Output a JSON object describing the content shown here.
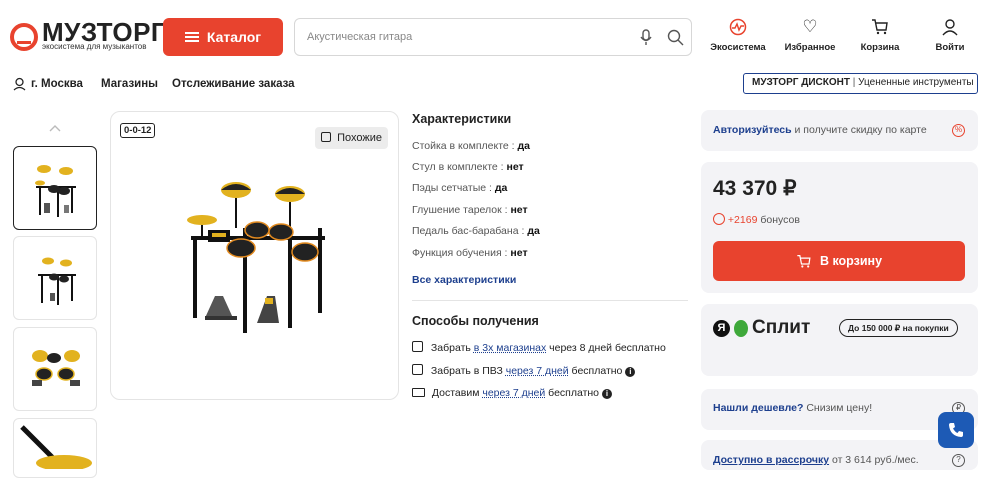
{
  "header": {
    "logo_title": "МУЗТОРГ",
    "logo_subtitle": "экосистема для музыкантов",
    "catalog_label": "Каталог",
    "search_placeholder": "Акустическая гитара",
    "icons": [
      {
        "label": "Экосистема",
        "icon": "ecosystem-icon"
      },
      {
        "label": "Избранное",
        "icon": "heart-icon"
      },
      {
        "label": "Корзина",
        "icon": "cart-icon"
      },
      {
        "label": "Войти",
        "icon": "user-icon"
      }
    ]
  },
  "subnav": {
    "city": "г. Москва",
    "stores": "Магазины",
    "tracking": "Отслеживание заказа",
    "discount_brand": "МУЗТОРГ ДИСКОНТ",
    "discount_sub": "Уцененные инструменты"
  },
  "product": {
    "age_badge": "0-0-12",
    "similar_label": "Похожие",
    "characteristics_title": "Характеристики",
    "characteristics": [
      {
        "name": "Стойка в комплекте",
        "value": "да"
      },
      {
        "name": "Стул в комплекте",
        "value": "нет"
      },
      {
        "name": "Пэды сетчатые",
        "value": "да"
      },
      {
        "name": "Глушение тарелок",
        "value": "нет"
      },
      {
        "name": "Педаль бас-барабана",
        "value": "да"
      },
      {
        "name": "Функция обучения",
        "value": "нет"
      }
    ],
    "all_characteristics": "Все характеристики",
    "receiving_title": "Способы получения",
    "receiving": {
      "pickup_prefix": "Забрать",
      "pickup_link": "в 3х магазинах",
      "pickup_suffix": "через 8 дней бесплатно",
      "pvz_prefix": "Забрать в ПВЗ",
      "pvz_link": "через 7 дней",
      "pvz_suffix": "бесплатно",
      "delivery_prefix": "Доставим",
      "delivery_link": "через 7 дней",
      "delivery_suffix": "бесплатно"
    }
  },
  "sidebar": {
    "auth_link": "Авторизуйтесь",
    "auth_text": "и получите скидку по карте",
    "price": "43 370 ₽",
    "bonus_value": "+2169",
    "bonus_label": "бонусов",
    "to_cart": "В корзину",
    "split_brand": "Сплит",
    "split_y": "Я",
    "split_limit": "До 150 000 ₽ на покупки",
    "cheaper_bold": "Нашли дешевле?",
    "cheaper_text": "Снизим цену!",
    "install_link": "Доступно в рассрочку",
    "install_text": "от 3 614 руб./мес."
  },
  "colors": {
    "accent": "#e8432e",
    "link": "#1d3f8e",
    "card": "#f3f3f6"
  }
}
